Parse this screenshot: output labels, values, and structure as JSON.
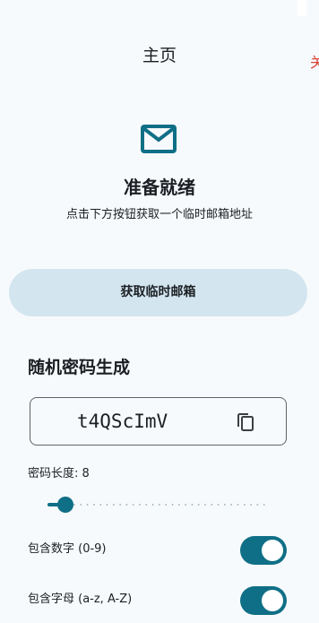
{
  "header": {
    "title": "主页",
    "edge_char": "关"
  },
  "hero": {
    "icon": "mail-icon",
    "title": "准备就绪",
    "subtitle": "点击下方按钮获取一个临时邮箱地址"
  },
  "actions": {
    "get_email_label": "获取临时邮箱"
  },
  "password_generator": {
    "title": "随机密码生成",
    "password": "t4QScImV",
    "copy_icon": "copy-icon",
    "length_label": "密码长度: 8",
    "length_value": 8,
    "options": [
      {
        "label": "包含数字 (0-9)",
        "enabled": true
      },
      {
        "label": "包含字母 (a-z, A-Z)",
        "enabled": true
      }
    ]
  },
  "colors": {
    "accent": "#0f6f86",
    "button_bg": "#d3e6ef",
    "edge_red": "#d8453b"
  }
}
